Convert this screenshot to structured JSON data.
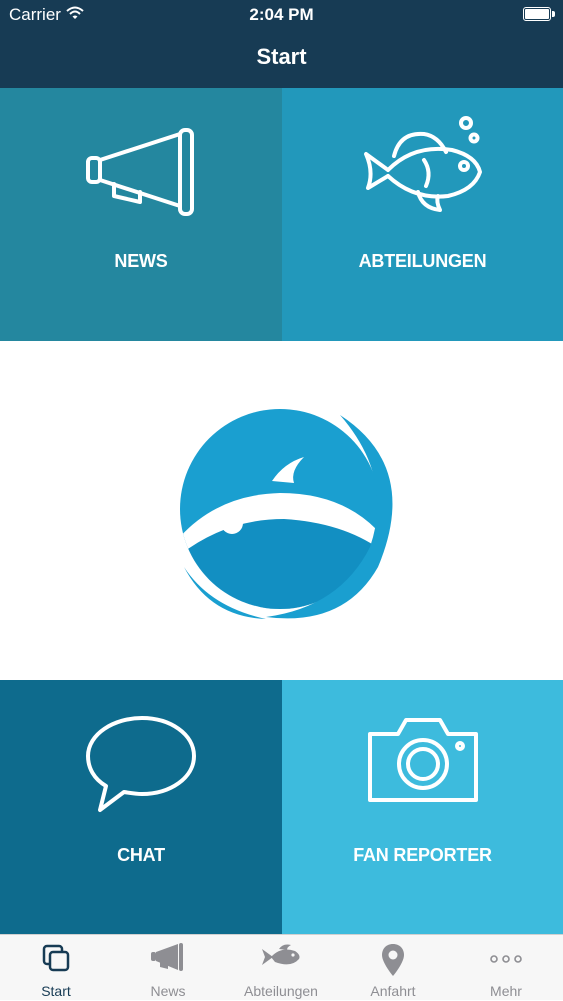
{
  "status_bar": {
    "carrier": "Carrier",
    "time": "2:04 PM"
  },
  "nav": {
    "title": "Start"
  },
  "tiles": {
    "news": {
      "label": "NEWS",
      "icon": "megaphone-icon"
    },
    "abteilungen": {
      "label": "ABTEILUNGEN",
      "icon": "fish-icon"
    },
    "chat": {
      "label": "CHAT",
      "icon": "speech-bubble-icon"
    },
    "fan_reporter": {
      "label": "FAN REPORTER",
      "icon": "camera-icon"
    }
  },
  "logo": {
    "icon": "fish-globe-logo"
  },
  "tabs": [
    {
      "label": "Start",
      "icon": "start-icon",
      "active": true
    },
    {
      "label": "News",
      "icon": "megaphone-icon"
    },
    {
      "label": "Abteilungen",
      "icon": "fish-icon"
    },
    {
      "label": "Anfahrt",
      "icon": "location-pin-icon"
    },
    {
      "label": "Mehr",
      "icon": "more-icon"
    }
  ],
  "colors": {
    "navbar": "#173b54",
    "news_tile": "#24879f",
    "abteilungen_tile": "#2298bb",
    "chat_tile": "#0e6b8d",
    "fan_reporter_tile": "#3dbbdd",
    "logo_blue": "#1a9fd0",
    "tab_active": "#173b54",
    "tab_inactive": "#8e8e93"
  }
}
